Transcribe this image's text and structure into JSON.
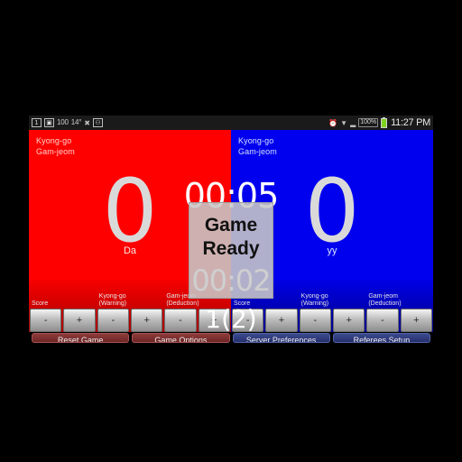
{
  "statusbar": {
    "left_icons": [
      {
        "name": "notification-count-badge",
        "glyph": "1"
      },
      {
        "name": "gallery-image-icon",
        "glyph": "▣"
      },
      {
        "name": "step-count-text",
        "glyph": "100"
      },
      {
        "name": "temperature-text",
        "glyph": "14°"
      },
      {
        "name": "sync-disabled-icon",
        "glyph": "✖"
      },
      {
        "name": "app-notification-icon",
        "glyph": "⚇"
      }
    ],
    "alarm_icon": "⏰",
    "wifi_icon": "▼",
    "signal_icon": "▂",
    "battery_percent": "100%",
    "clock": "11:27 PM"
  },
  "board": {
    "red": {
      "penalty_labels": [
        "Kyong-go",
        "Gam-jeom"
      ],
      "player_name": "Da",
      "score": "0",
      "controls": [
        {
          "title_line1": "Score",
          "title_line2": "",
          "minus": "-",
          "plus": "+"
        },
        {
          "title_line1": "Kyong-go",
          "title_line2": "(Warning)",
          "minus": "-",
          "plus": "+"
        },
        {
          "title_line1": "Gam-jeom",
          "title_line2": "(Deduction)",
          "minus": "-",
          "plus": "+"
        }
      ]
    },
    "blue": {
      "penalty_labels": [
        "Kyong-go",
        "Gam-jeom"
      ],
      "player_name": "yy",
      "score": "0",
      "controls": [
        {
          "title_line1": "Score",
          "title_line2": "",
          "minus": "-",
          "plus": "+"
        },
        {
          "title_line1": "Kyong-go",
          "title_line2": "(Warning)",
          "minus": "-",
          "plus": "+"
        },
        {
          "title_line1": "Gam-jeom",
          "title_line2": "(Deduction)",
          "minus": "-",
          "plus": "+"
        }
      ]
    },
    "center": {
      "match_time": "00:05",
      "rest_time": "00:02",
      "round_indicator": "1(2)"
    }
  },
  "dialog": {
    "state_text": "Game Ready"
  },
  "buttonbar": [
    {
      "label": "Reset Game",
      "color": "red"
    },
    {
      "label": "Game Options",
      "color": "red"
    },
    {
      "label": "Server Preferences",
      "color": "blue"
    },
    {
      "label": "Referees Setup",
      "color": "blue"
    }
  ],
  "colors": {
    "red_side": "#ff0000",
    "blue_side": "#0000ee",
    "score_text": "#d9d9d9",
    "dialog_bg": "#c8c8c8",
    "battery": "#7ed321"
  }
}
